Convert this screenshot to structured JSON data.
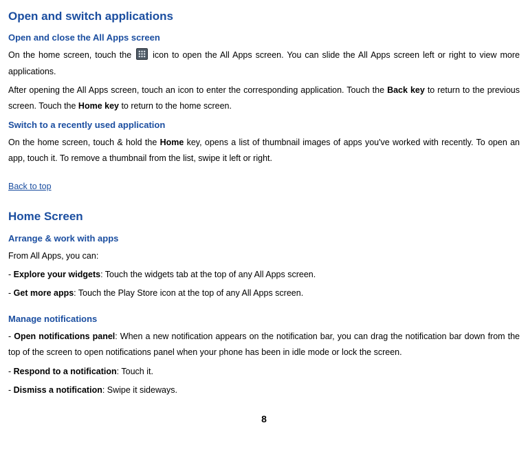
{
  "section1": {
    "title": "Open and switch applications",
    "sub1": {
      "title": "Open and close the All Apps screen",
      "p1a": "On the home screen, touch the ",
      "p1b": " icon to open the All Apps screen. You can slide the All Apps screen left or right to view more applications.",
      "p2a": "After opening the All Apps screen, touch an icon to enter the corresponding application. Touch the ",
      "p2b": "Back key",
      "p2c": " to return to the previous screen. Touch the ",
      "p2d": "Home key",
      "p2e": " to return to the home screen."
    },
    "sub2": {
      "title": "Switch to a recently used application",
      "p1a": "On the home screen, touch & hold the ",
      "p1b": "Home",
      "p1c": " key, opens a list of thumbnail images of apps you've worked with recently. To open an app, touch it. To remove a thumbnail from the list, swipe it left or right."
    }
  },
  "backlink": "Back to top",
  "section2": {
    "title": "Home Screen",
    "sub1": {
      "title": "Arrange & work with apps",
      "intro": "From All Apps, you can:",
      "li1a": "Explore your widgets",
      "li1b": ": Touch the widgets tab at the top of any All Apps screen.",
      "li2a": "Get more apps",
      "li2b": ": Touch the Play Store icon at the top of any All Apps screen."
    },
    "sub2": {
      "title": "Manage notifications",
      "li1a": "Open notifications panel",
      "li1b": ": When a new notification appears on the notification bar, you can drag the notification bar down from the top of the screen to open notifications panel when your phone has been in idle mode or lock the screen.",
      "li2a": "Respond to a notification",
      "li2b": ": Touch it.",
      "li3a": "Dismiss a notification",
      "li3b": ": Swipe it sideways."
    }
  },
  "page": "8"
}
